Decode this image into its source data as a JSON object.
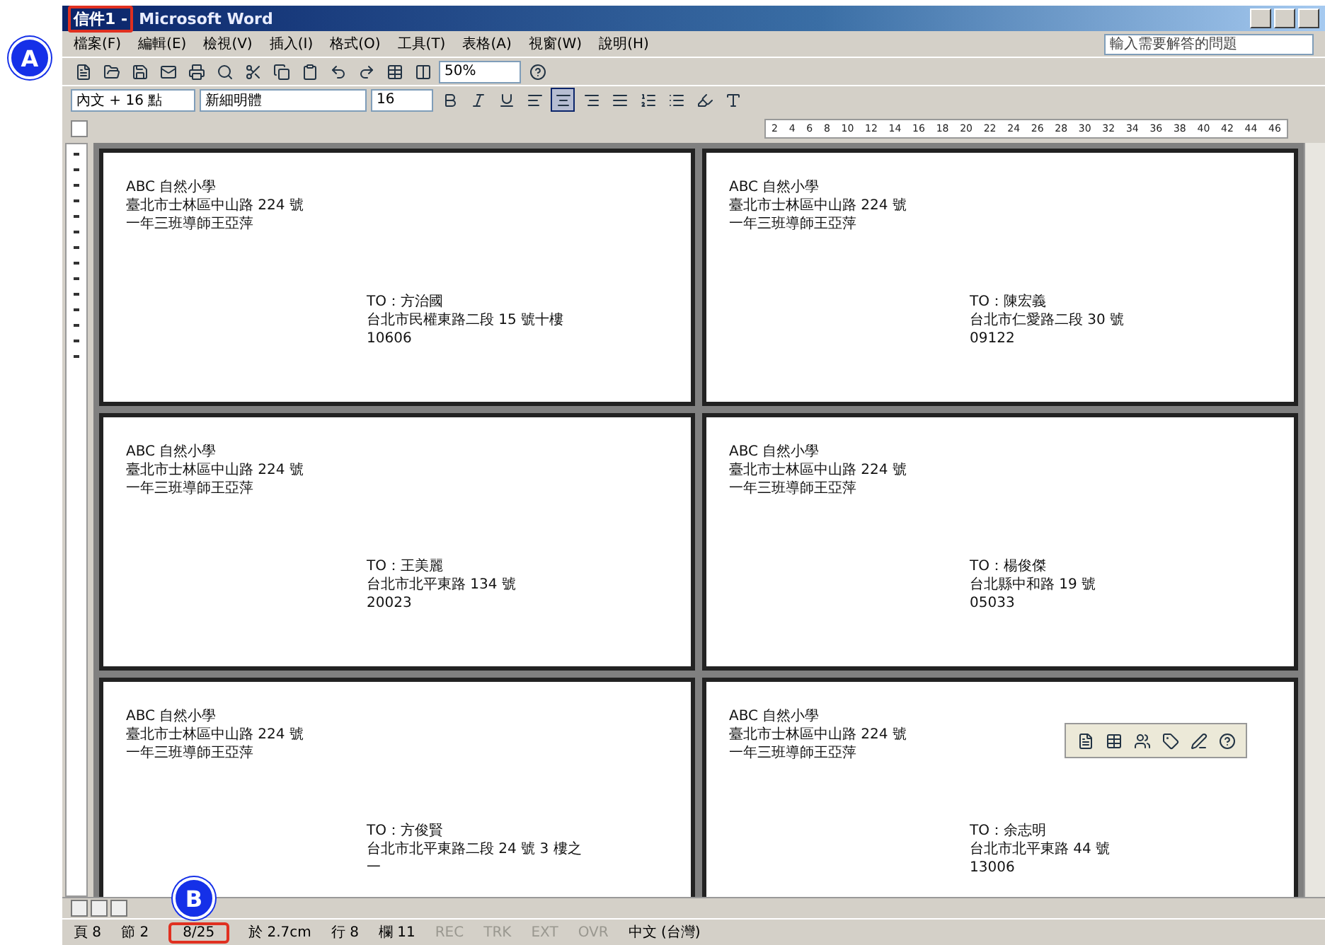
{
  "annotations": [
    {
      "label": "A"
    },
    {
      "label": "B"
    }
  ],
  "window": {
    "title_highlighted": "信件1 -",
    "title": "Microsoft Word"
  },
  "menu": [
    "檔案(F)",
    "編輯(E)",
    "檢視(V)",
    "插入(I)",
    "格式(O)",
    "工具(T)",
    "表格(A)",
    "視窗(W)",
    "說明(H)"
  ],
  "help_box": {
    "placeholder": "輸入需要解答的問題"
  },
  "standard_toolbar": {
    "zoom": "50%"
  },
  "formatting_toolbar": {
    "style": "內文 + 16 點",
    "font": "新細明體",
    "size": "16",
    "alignment": [
      {
        "selected": false
      },
      {
        "selected": true
      },
      {
        "selected": false
      },
      {
        "selected": false
      }
    ]
  },
  "ruler": {
    "ticks": [
      "2",
      "4",
      "6",
      "8",
      "10",
      "12",
      "14",
      "16",
      "18",
      "20",
      "22",
      "24",
      "26",
      "28",
      "30",
      "32",
      "34",
      "36",
      "38",
      "40",
      "42",
      "44",
      "46"
    ]
  },
  "labels": [
    {
      "sender": [
        "ABC 自然小學",
        "臺北市士林區中山路 224 號",
        "一年三班導師王亞萍"
      ],
      "recipient": [
        "TO：方治國",
        "台北市民權東路二段 15 號十樓",
        "10606"
      ]
    },
    {
      "sender": [
        "ABC 自然小學",
        "臺北市士林區中山路 224 號",
        "一年三班導師王亞萍"
      ],
      "recipient": [
        "TO：陳宏義",
        "台北市仁愛路二段 30 號",
        "09122"
      ]
    },
    {
      "sender": [
        "ABC 自然小學",
        "臺北市士林區中山路 224 號",
        "一年三班導師王亞萍"
      ],
      "recipient": [
        "TO：王美麗",
        "台北市北平東路 134 號",
        "20023"
      ]
    },
    {
      "sender": [
        "ABC 自然小學",
        "臺北市士林區中山路 224 號",
        "一年三班導師王亞萍"
      ],
      "recipient": [
        "TO：楊俊傑",
        "台北縣中和路 19 號",
        "05033"
      ]
    },
    {
      "sender": [
        "ABC 自然小學",
        "臺北市士林區中山路 224 號",
        "一年三班導師王亞萍"
      ],
      "recipient": [
        "TO：方俊賢",
        "台北市北平東路二段 24 號 3 樓之",
        "一"
      ]
    },
    {
      "sender": [
        "ABC 自然小學",
        "臺北市士林區中山路 224 號",
        "一年三班導師王亞萍"
      ],
      "recipient": [
        "TO：余志明",
        "台北市北平東路 44 號",
        "13006"
      ]
    }
  ],
  "status_bar": {
    "items": [
      "頁 8",
      "節 2"
    ],
    "page_highlighted": "8/25",
    "position": [
      "於 2.7cm",
      "行 8",
      "欄 11"
    ],
    "modes": [
      {
        "label": "REC",
        "on": false
      },
      {
        "label": "TRK",
        "on": false
      },
      {
        "label": "EXT",
        "on": false
      },
      {
        "label": "OVR",
        "on": false
      }
    ],
    "language": "中文 (台灣)"
  }
}
